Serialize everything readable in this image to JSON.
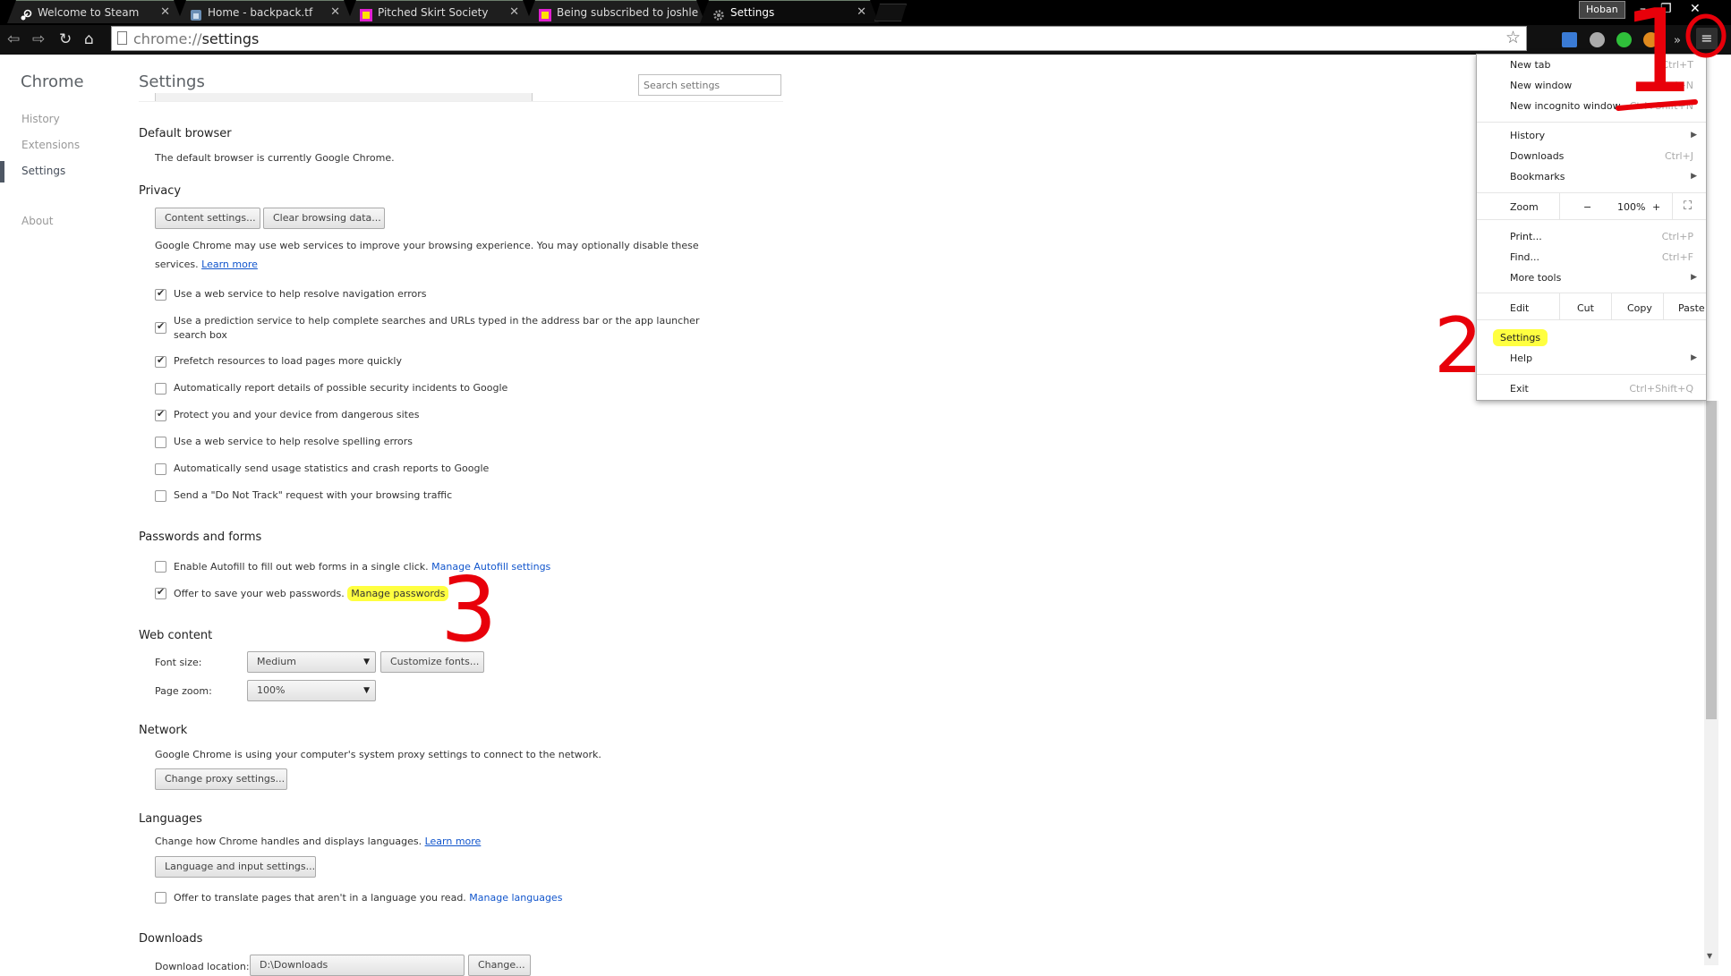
{
  "tabs": [
    {
      "title": "Welcome to Steam",
      "icon": "steam-icon",
      "active": false
    },
    {
      "title": "Home - backpack.tf",
      "icon": "backpack-icon",
      "active": false
    },
    {
      "title": "Pitched Skirt Society",
      "icon": "group-icon",
      "active": false
    },
    {
      "title": "Being subscribed to joshle",
      "icon": "group-icon",
      "active": false
    },
    {
      "title": "Settings",
      "icon": "gear-icon",
      "active": true
    }
  ],
  "window": {
    "profile_name": "Hoban",
    "close_glyph": "✕"
  },
  "omnibox": {
    "scheme": "chrome://",
    "path": "settings"
  },
  "nav": {
    "brand": "Chrome",
    "history": "History",
    "extensions": "Extensions",
    "settings": "Settings",
    "about": "About"
  },
  "settings": {
    "title": "Settings",
    "search_placeholder": "Search settings",
    "default_browser": {
      "heading": "Default browser",
      "text": "The default browser is currently Google Chrome."
    },
    "privacy": {
      "heading": "Privacy",
      "content_settings_btn": "Content settings...",
      "clear_data_btn": "Clear browsing data...",
      "description_1": "Google Chrome may use web services to improve your browsing experience. You may optionally disable these",
      "description_2": "services.",
      "learn_more": "Learn more",
      "options": [
        {
          "label": "Use a web service to help resolve navigation errors",
          "checked": true
        },
        {
          "label": "Use a prediction service to help complete searches and URLs typed in the address bar or the app launcher",
          "label2": "search box",
          "checked": true
        },
        {
          "label": "Prefetch resources to load pages more quickly",
          "checked": true
        },
        {
          "label": "Automatically report details of possible security incidents to Google",
          "checked": false
        },
        {
          "label": "Protect you and your device from dangerous sites",
          "checked": true
        },
        {
          "label": "Use a web service to help resolve spelling errors",
          "checked": false
        },
        {
          "label": "Automatically send usage statistics and crash reports to Google",
          "checked": false
        },
        {
          "label": "Send a \"Do Not Track\" request with your browsing traffic",
          "checked": false
        }
      ]
    },
    "passwords": {
      "heading": "Passwords and forms",
      "autofill_label": "Enable Autofill to fill out web forms in a single click.",
      "autofill_link": "Manage Autofill settings",
      "autofill_checked": false,
      "save_pw_label": "Offer to save your web passwords.",
      "save_pw_link": "Manage passwords",
      "save_pw_checked": true
    },
    "web_content": {
      "heading": "Web content",
      "font_size_label": "Font size:",
      "font_size_value": "Medium",
      "customize_fonts_btn": "Customize fonts...",
      "page_zoom_label": "Page zoom:",
      "page_zoom_value": "100%"
    },
    "network": {
      "heading": "Network",
      "text": "Google Chrome is using your computer's system proxy settings to connect to the network.",
      "proxy_btn": "Change proxy settings..."
    },
    "languages": {
      "heading": "Languages",
      "text": "Change how Chrome handles and displays languages.",
      "learn_more": "Learn more",
      "lang_btn": "Language and input settings...",
      "translate_label": "Offer to translate pages that aren't in a language you read.",
      "translate_link": "Manage languages",
      "translate_checked": false
    },
    "downloads": {
      "heading": "Downloads",
      "location_label": "Download location:",
      "location_value": "D:\\Downloads",
      "change_btn": "Change..."
    }
  },
  "menu": {
    "new_tab": "New tab",
    "new_tab_sc": "Ctrl+T",
    "new_window": "New window",
    "new_window_sc": "Ctrl+N",
    "incognito": "New incognito window",
    "incognito_sc": "Ctrl+Shift+N",
    "history": "History",
    "downloads": "Downloads",
    "downloads_sc": "Ctrl+J",
    "bookmarks": "Bookmarks",
    "zoom": "Zoom",
    "zoom_minus": "−",
    "zoom_value": "100%",
    "zoom_plus": "+",
    "print": "Print...",
    "print_sc": "Ctrl+P",
    "find": "Find...",
    "find_sc": "Ctrl+F",
    "more_tools": "More tools",
    "edit": "Edit",
    "cut": "Cut",
    "copy": "Copy",
    "paste": "Paste",
    "settings": "Settings",
    "help": "Help",
    "exit": "Exit",
    "exit_sc": "Ctrl+Shift+Q"
  },
  "annotations": {
    "step1": "1",
    "step2": "2",
    "step3": "3"
  },
  "colors": {
    "highlight": "#ffff40",
    "annotation_red": "#e8000a",
    "link": "#1155cc"
  }
}
